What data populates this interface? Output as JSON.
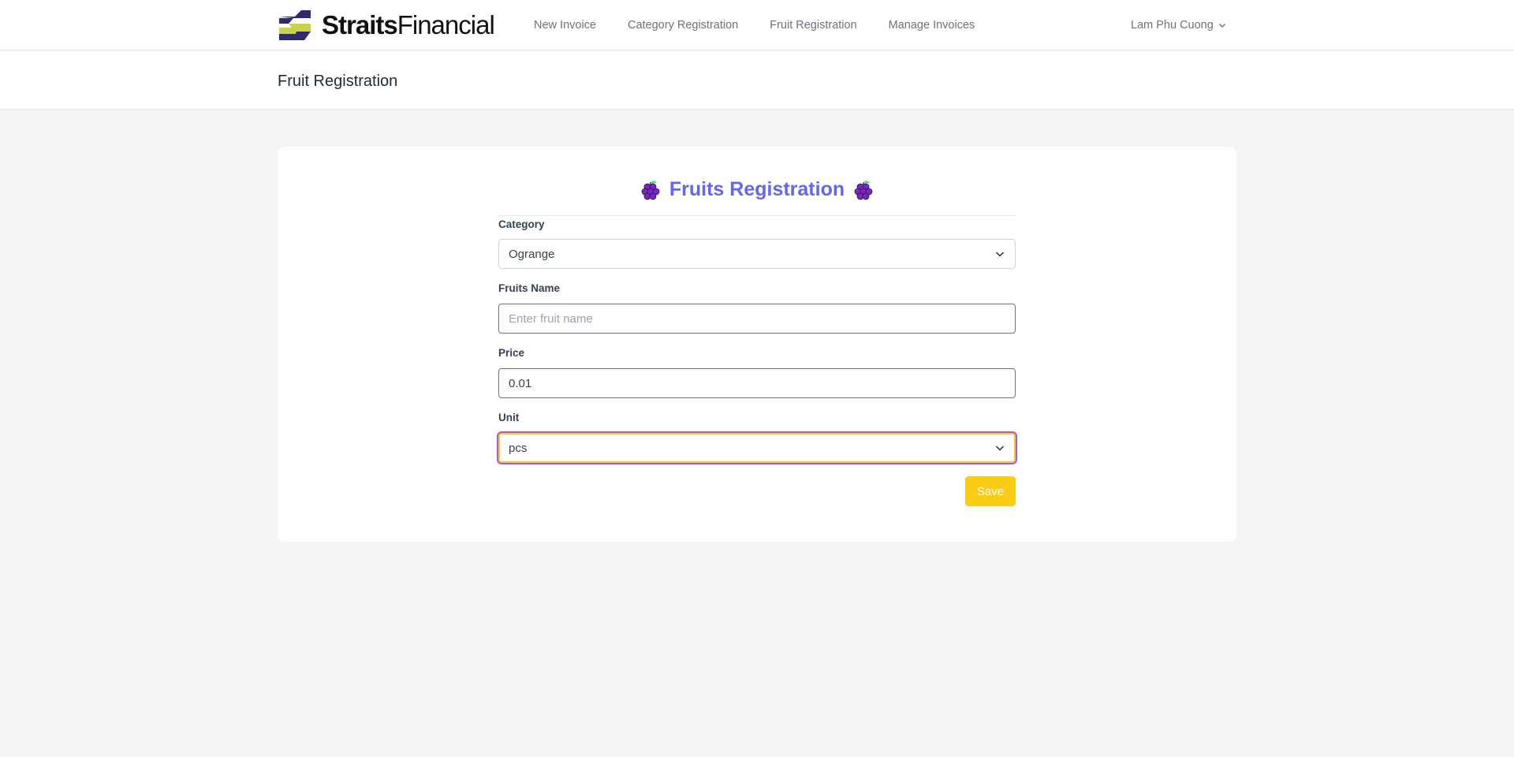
{
  "brand": {
    "name_bold": "Straits",
    "name_light": "Financial"
  },
  "nav": {
    "links": [
      "New Invoice",
      "Category Registration",
      "Fruit Registration",
      "Manage Invoices"
    ],
    "user_name": "Lam Phu Cuong"
  },
  "header": {
    "title": "Fruit Registration"
  },
  "form": {
    "title": "Fruits Registration",
    "category_label": "Category",
    "category_value": "Ograngе",
    "fruit_name_label": "Fruits Name",
    "fruit_name_placeholder": "Enter fruit name",
    "price_label": "Price",
    "price_value": "0.01",
    "unit_label": "Unit",
    "unit_value": "pcs",
    "save_label": "Save"
  },
  "colors": {
    "accent": "#6366f1",
    "button": "#facc15",
    "focus_ring": "#a855f7"
  },
  "icons": [
    "logo-mark-icon",
    "grape-icon",
    "chevron-down-icon"
  ]
}
